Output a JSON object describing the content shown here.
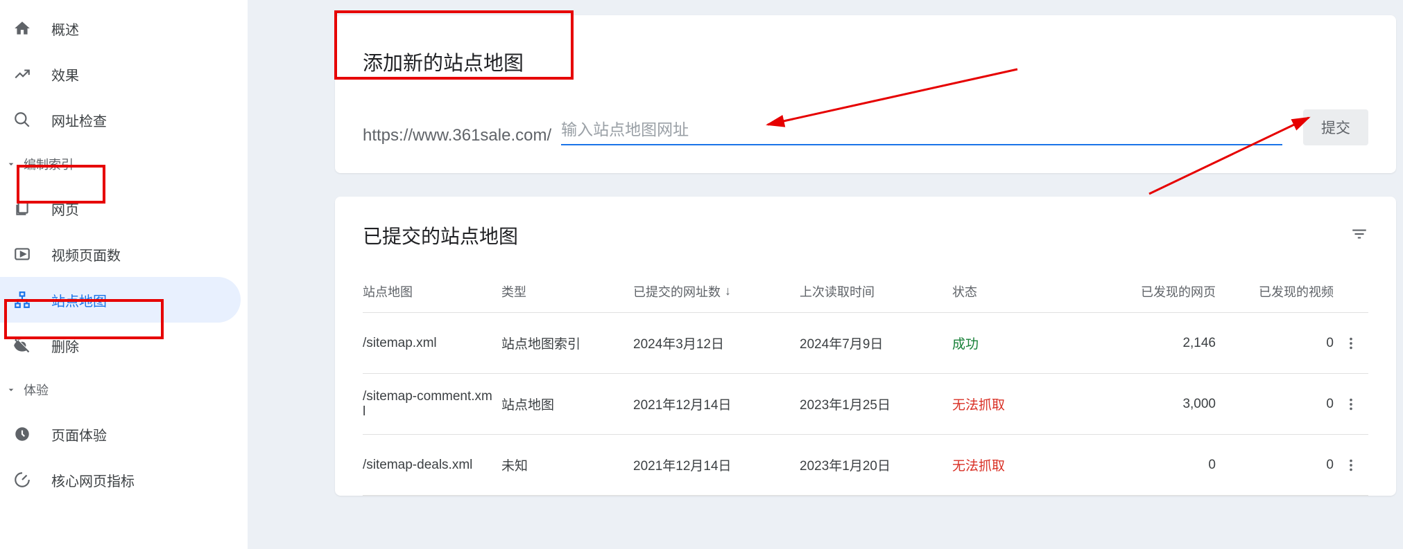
{
  "sidebar": {
    "items_top": [
      {
        "label": "概述",
        "icon": "home"
      },
      {
        "label": "效果",
        "icon": "trending"
      },
      {
        "label": "网址检查",
        "icon": "search"
      }
    ],
    "section_index": {
      "label": "编制索引"
    },
    "items_index": [
      {
        "label": "网页",
        "icon": "pages"
      },
      {
        "label": "视频页面数",
        "icon": "video"
      },
      {
        "label": "站点地图",
        "icon": "sitemap"
      },
      {
        "label": "删除",
        "icon": "remove"
      }
    ],
    "section_experience": {
      "label": "体验"
    },
    "items_experience": [
      {
        "label": "页面体验",
        "icon": "badge"
      },
      {
        "label": "核心网页指标",
        "icon": "speed"
      }
    ]
  },
  "add_card": {
    "title": "添加新的站点地图",
    "prefix": "https://www.361sale.com/",
    "placeholder": "输入站点地图网址",
    "submit_label": "提交"
  },
  "list_card": {
    "title": "已提交的站点地图",
    "columns": {
      "sitemap": "站点地图",
      "type": "类型",
      "submitted": "已提交的网址数",
      "last_read": "上次读取时间",
      "status": "状态",
      "pages_found": "已发现的网页",
      "videos_found": "已发现的视频"
    },
    "rows": [
      {
        "sitemap": "/sitemap.xml",
        "type": "站点地图索引",
        "submitted": "2024年3月12日",
        "last_read": "2024年7月9日",
        "status": "成功",
        "status_class": "status-success",
        "pages": "2,146",
        "videos": "0"
      },
      {
        "sitemap": "/sitemap-comment.xml",
        "type": "站点地图",
        "submitted": "2021年12月14日",
        "last_read": "2023年1月25日",
        "status": "无法抓取",
        "status_class": "status-fail",
        "pages": "3,000",
        "videos": "0"
      },
      {
        "sitemap": "/sitemap-deals.xml",
        "type": "未知",
        "submitted": "2021年12月14日",
        "last_read": "2023年1月20日",
        "status": "无法抓取",
        "status_class": "status-fail",
        "pages": "0",
        "videos": "0"
      }
    ]
  }
}
